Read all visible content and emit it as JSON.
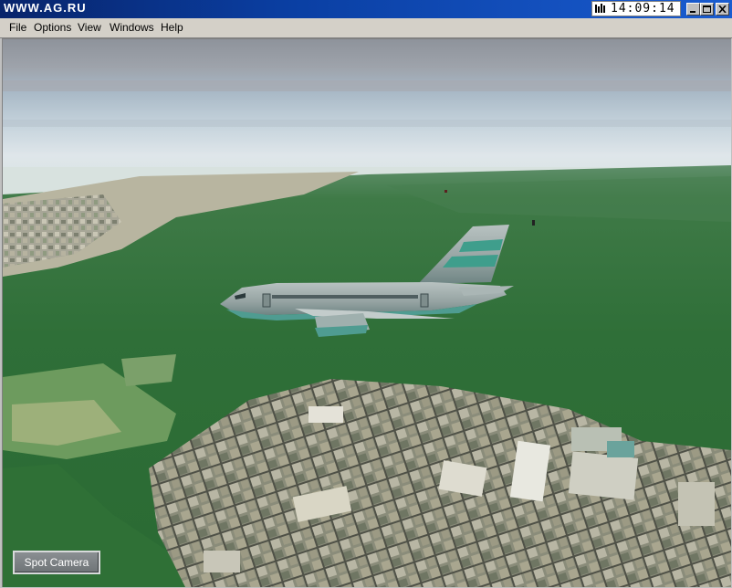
{
  "window": {
    "title": "WWW.AG.RU",
    "clock": "14:09:14"
  },
  "menu": {
    "items": [
      "File",
      "Options",
      "Windows",
      "Help"
    ],
    "view": "View"
  },
  "overlay": {
    "spot_camera_label": "Spot Camera"
  },
  "colors": {
    "title_bar": "#0a3fa3",
    "sky_top": "#8f949c",
    "forest": "#2d6b35",
    "aircraft_body": "#9aa7a6",
    "aircraft_stripe": "#3f9e8c"
  }
}
